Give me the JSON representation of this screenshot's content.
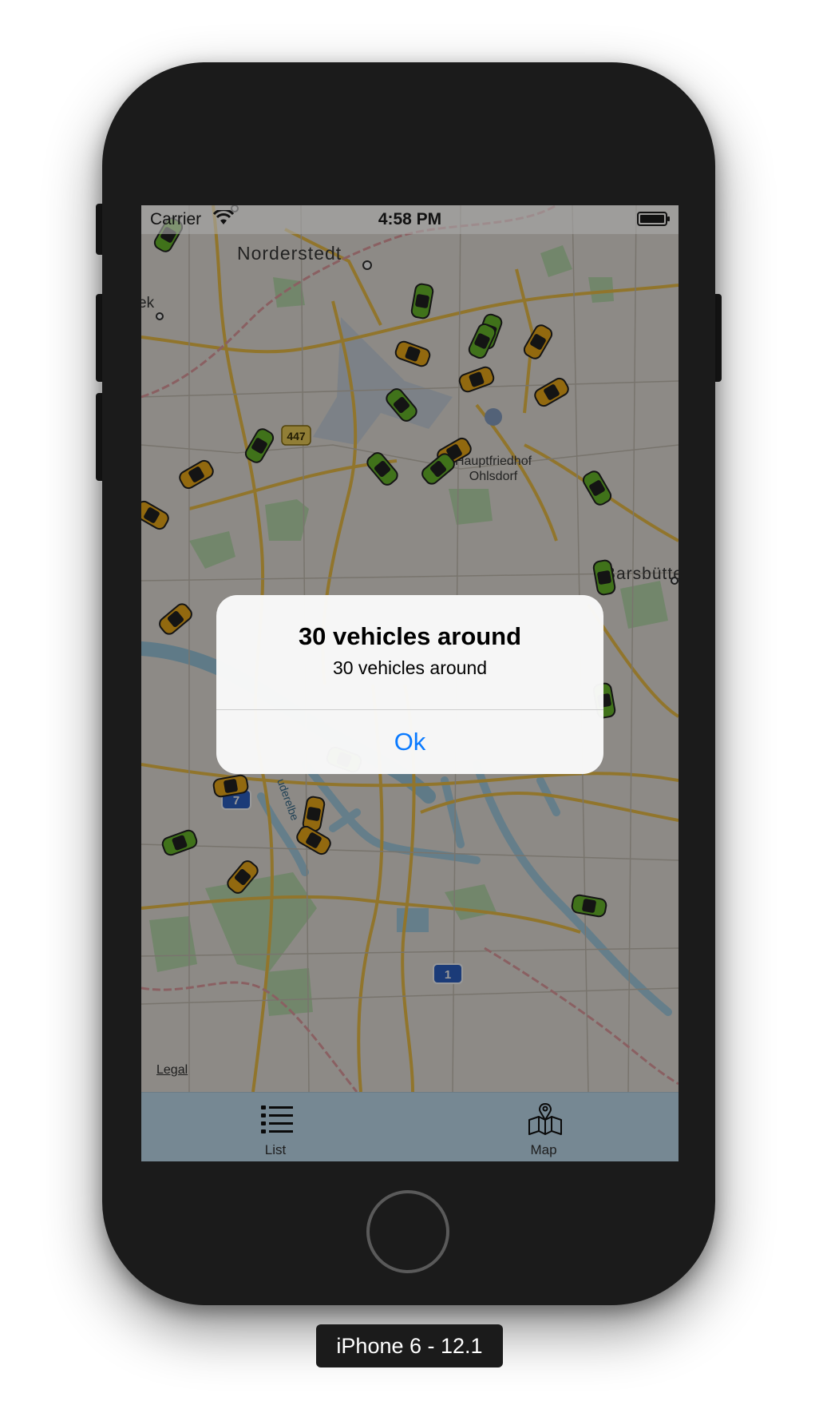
{
  "status_bar": {
    "carrier": "Carrier",
    "time": "4:58 PM"
  },
  "map": {
    "places": [
      "Norderstedt",
      "ek",
      "Hauptfriedhof",
      "Ohlsdorf",
      "Barsbüttel",
      "uderelbe"
    ],
    "road_shields": [
      "447",
      "7",
      "1"
    ],
    "legal": "Legal",
    "vehicle_colors": {
      "yellow": "#f4b019",
      "green": "#6cbf2c"
    }
  },
  "alert": {
    "title": "30 vehicles around",
    "message": "30 vehicles around",
    "button": "Ok"
  },
  "tabs": [
    {
      "label": "List",
      "icon": "list-icon"
    },
    {
      "label": "Map",
      "icon": "map-icon"
    }
  ],
  "device_label": "iPhone 6 - 12.1"
}
